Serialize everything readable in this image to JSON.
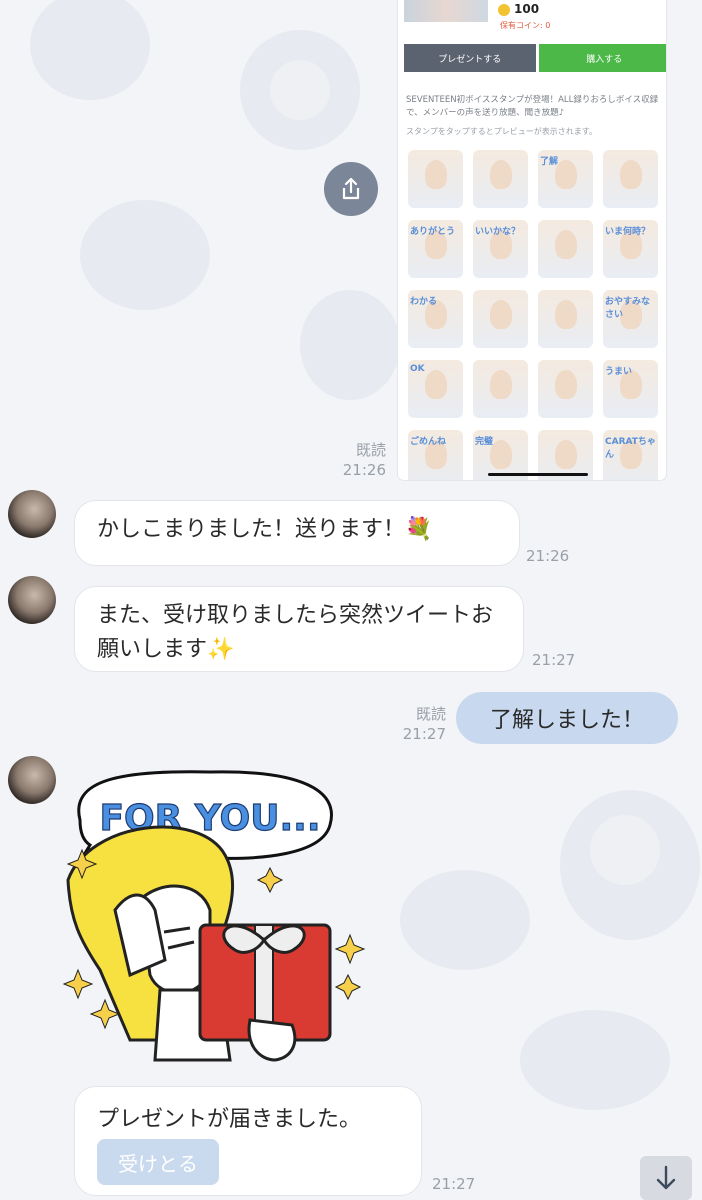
{
  "shared_screenshot": {
    "coins": "100",
    "coin_label": "保有コイン: 0",
    "present_button": "プレゼントする",
    "buy_button": "購入する",
    "description": "SEVENTEEN初ボイススタンプが登場！ALL録りおろしボイス収録で、メンバーの声を送り放題、聞き放題♪",
    "hint": "スタンプをタップするとプレビューが表示されます。",
    "sticker_labels": [
      "",
      "",
      "了解",
      "",
      "ありがとう",
      "いいかな？",
      "",
      "いま何時？",
      "わかる",
      "",
      "",
      "おやすみなさい",
      "OK",
      "",
      "",
      "うまい",
      "ごめんね",
      "完璧",
      "",
      "CARATちゃん"
    ]
  },
  "messages": [
    {
      "read": "既読",
      "time": "21:26"
    },
    {
      "text": "かしこまりました！送ります！💐",
      "time": "21:26"
    },
    {
      "text": "また、受け取りましたら突然ツイートお願いします✨",
      "time": "21:27"
    },
    {
      "read": "既読",
      "time": "21:27",
      "text": "了解しました！"
    }
  ],
  "gift": {
    "sticker_caption": "FOR YOU...",
    "text": "プレゼントが届きました。",
    "button": "受けとる",
    "time": "21:27"
  },
  "icons": {
    "share": "share-icon",
    "scroll": "arrow-down-icon"
  }
}
